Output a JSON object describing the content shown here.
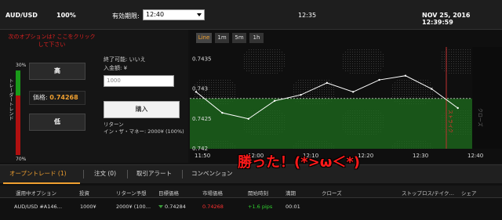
{
  "topbar": {
    "pair": "AUD/USD",
    "percent": "100%",
    "expiry_label": "有効期限:",
    "expiry_value": "12:40",
    "clock": "12:35",
    "datetime": "NOV 25, 2016 12:39:59"
  },
  "left": {
    "warning": "次のオプションは? ここをクリックして下さい",
    "trend_label": "トレーダートレンド",
    "trend_high_pct": "30%",
    "trend_low_pct": "70%",
    "trend_high_fraction": 0.3,
    "high_button": "高",
    "low_button": "低",
    "price_label": "価格:",
    "price_value": "0.74268",
    "close_possible": "終了可能: いいえ",
    "amount_label": "入金額: ¥",
    "amount_placeholder": "1000",
    "buy_button": "購入",
    "return_label": "リターン",
    "return_value": "イン・ザ・マネー: 2000¥ (100%)"
  },
  "chart": {
    "tabs": [
      "Line",
      "1m",
      "5m",
      "1h"
    ],
    "active_tab": "Line",
    "y_ticks": [
      "0.7435",
      "0.743",
      "0.7425",
      "0.742"
    ],
    "x_ticks": [
      "11:50",
      "12:00",
      "12:10",
      "12:20",
      "12:30",
      "12:40"
    ],
    "strike_label": "ストライク",
    "expiry_marker_label": "クローズ",
    "strike_price": 0.74284,
    "green_color": "#1e6e1e",
    "line_color": "#ffffff"
  },
  "chart_data": {
    "type": "line",
    "x": [
      "11:50",
      "11:55",
      "12:00",
      "12:05",
      "12:10",
      "12:15",
      "12:20",
      "12:25",
      "12:30",
      "12:35",
      "12:38"
    ],
    "values": [
      0.74295,
      0.7426,
      0.7425,
      0.7428,
      0.7429,
      0.7431,
      0.74295,
      0.74315,
      0.74322,
      0.743,
      0.74268
    ],
    "ylim": [
      0.742,
      0.7437
    ],
    "strike": 0.74284
  },
  "overlay_text": "勝った！(*>ω＜*)",
  "bottom_tabs": [
    {
      "label": "オープントレード (1)",
      "active": true
    },
    {
      "label": "注文 (0)",
      "active": false
    },
    {
      "label": "取引アラート",
      "active": false
    },
    {
      "label": "コンベンション",
      "active": false
    }
  ],
  "table": {
    "headers": [
      "運用中オプション",
      "投資",
      "リターン予想",
      "目標価格",
      "市場価格",
      "開始時刻",
      "満期",
      "クローズ",
      "ストップロス/テイク…",
      "シェア"
    ],
    "row": [
      "AUD/USD #A146…",
      "1000¥",
      "2000¥ (100…",
      "0.74284",
      "0.74268",
      "+1.6 pips",
      "00:01",
      "",
      "",
      ""
    ]
  }
}
